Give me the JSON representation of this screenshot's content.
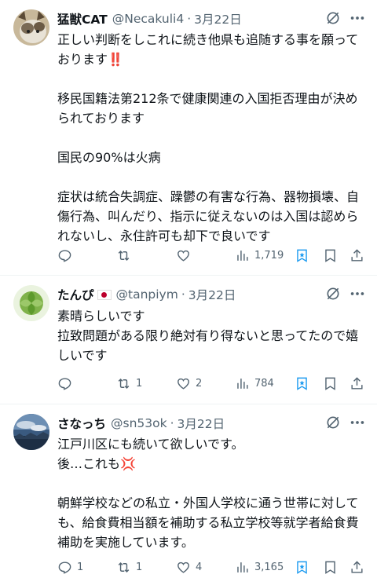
{
  "tweets": [
    {
      "name": "猛獣CAT",
      "handle": "@Necakuli4",
      "date": "3月22日",
      "text": "正しい判断をしこれに続き他県も追随する事を願っております‼️\n\n移民国籍法第212条で健康関連の入国拒否理由が決められております\n\n国民の90%は火病\n\n症状は統合失調症、躁鬱の有害な行為、器物損壊、自傷行為、叫んだり、指示に従えないのは入国は認められないし、永住許可も却下で良いです",
      "replies": "",
      "retweets": "",
      "likes": "",
      "views": "1,719"
    },
    {
      "name": "たんぴ",
      "handle": "@tanpiym",
      "date": "3月22日",
      "text": "素晴らしいです\n拉致問題がある限り絶対有り得ないと思ってたので嬉しいです",
      "replies": "",
      "retweets": "1",
      "likes": "2",
      "views": "784"
    },
    {
      "name": "さなっち",
      "handle": "@sn53ok",
      "date": "3月22日",
      "text": "江戸川区にも続いて欲しいです。\n後…これも💢\n\n朝鮮学校などの私立・外国人学校に通う世帯に対しても、給食費相当額を補助する私立学校等就学者給食費補助を実施しています。",
      "replies": "1",
      "retweets": "1",
      "likes": "4",
      "views": "3,165"
    }
  ],
  "colors": {
    "text": "#0f1419",
    "muted": "#536471",
    "accent": "#1d9bf0",
    "divider": "#eff3f4"
  },
  "icons": [
    "grok-icon",
    "more-icon",
    "reply-icon",
    "retweet-icon",
    "like-icon",
    "views-icon",
    "bookmark-icon",
    "share-icon"
  ]
}
